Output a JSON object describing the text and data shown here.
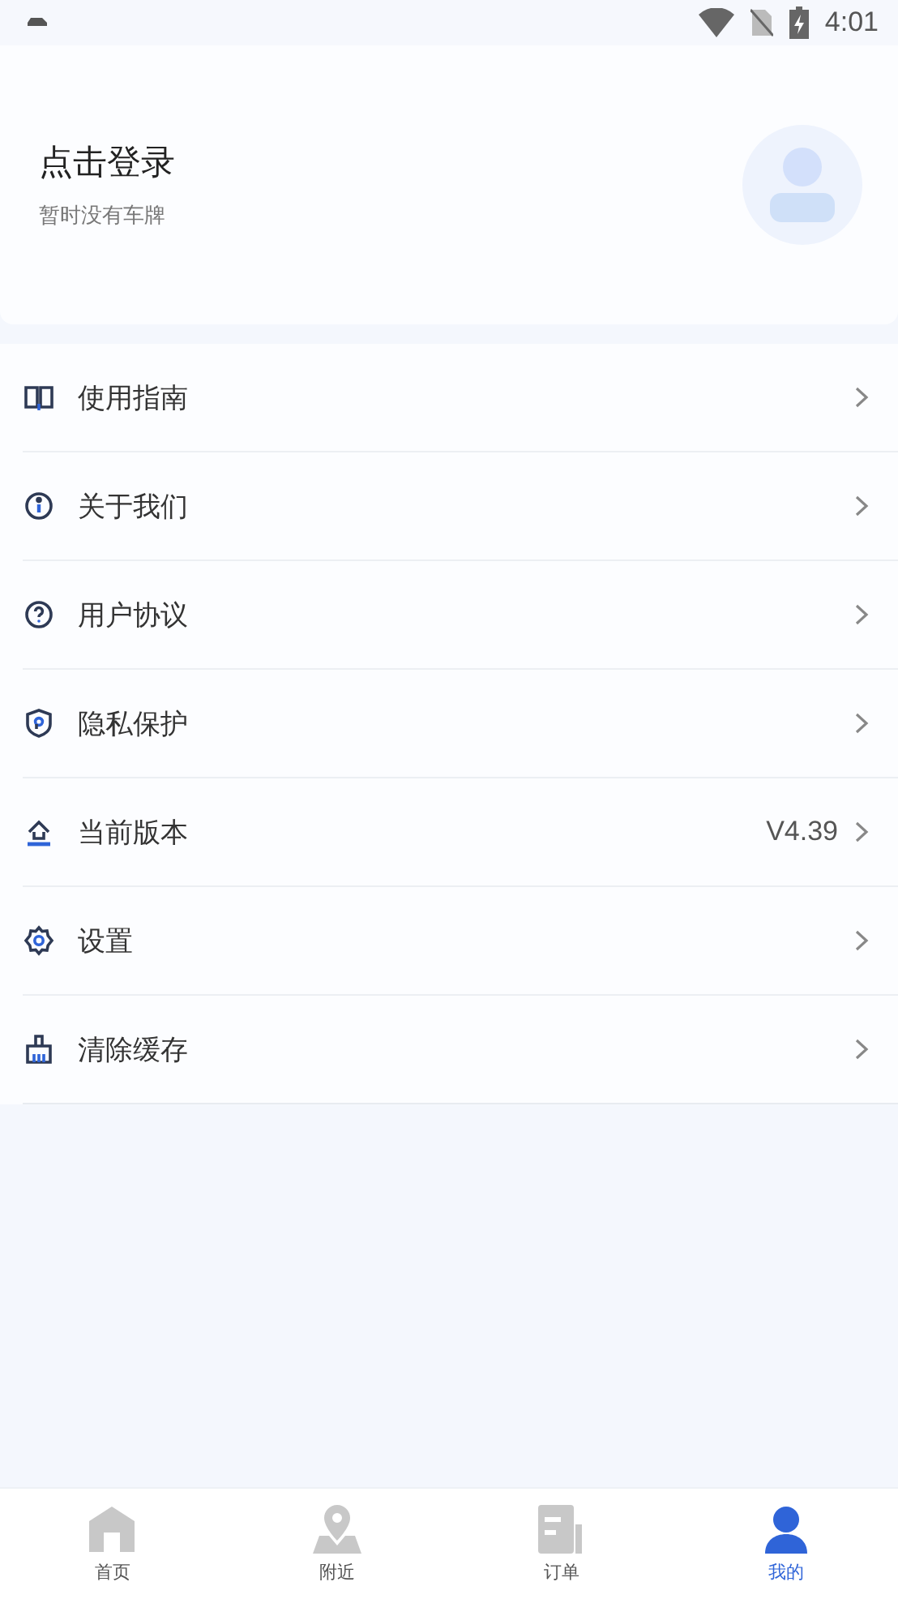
{
  "status_bar": {
    "time": "4:01"
  },
  "profile": {
    "title": "点击登录",
    "subtitle": "暂时没有车牌"
  },
  "menu": [
    {
      "kind": "book",
      "label": "使用指南"
    },
    {
      "kind": "info",
      "label": "关于我们"
    },
    {
      "kind": "help",
      "label": "用户协议"
    },
    {
      "kind": "shield",
      "label": "隐私保护"
    },
    {
      "kind": "upload",
      "label": "当前版本",
      "value": "V4.39"
    },
    {
      "kind": "gear",
      "label": "设置"
    },
    {
      "kind": "broom",
      "label": "清除缓存"
    }
  ],
  "tabs": [
    {
      "kind": "home",
      "label": "首页",
      "selected": false
    },
    {
      "kind": "pin",
      "label": "附近",
      "selected": false
    },
    {
      "kind": "doc",
      "label": "订单",
      "selected": false
    },
    {
      "kind": "user",
      "label": "我的",
      "selected": true
    }
  ]
}
